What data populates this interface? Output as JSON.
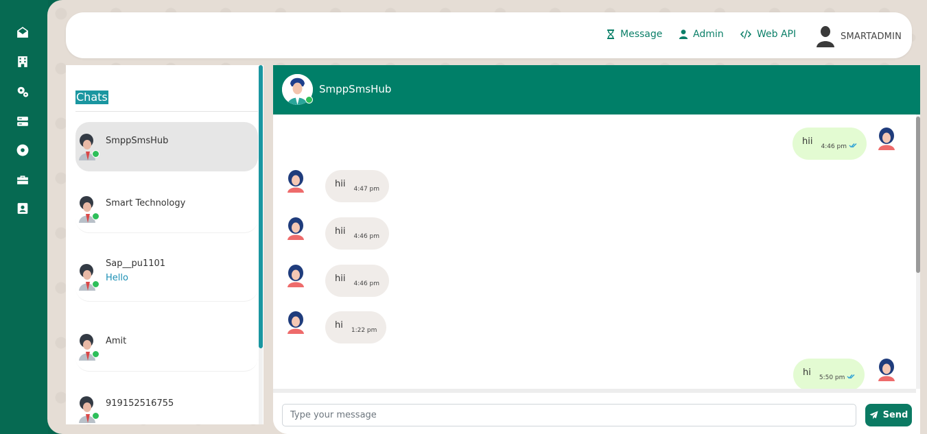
{
  "sidebar": {
    "icons": [
      "envelope-open-icon",
      "building-icon",
      "cogs-icon",
      "server-icon",
      "dot-circle-icon",
      "toolbox-icon",
      "id-badge-icon"
    ]
  },
  "topbar": {
    "nav": [
      {
        "label": "Message",
        "icon": "hourglass-icon"
      },
      {
        "label": "Admin",
        "icon": "user-icon"
      },
      {
        "label": "Web API",
        "icon": "code-icon"
      }
    ],
    "user_name": "SMARTADMIN"
  },
  "chats": {
    "title": "Chats",
    "items": [
      {
        "name": "SmppSmsHub",
        "preview": "",
        "active": true
      },
      {
        "name": "Smart Technology",
        "preview": ""
      },
      {
        "name": "Sap__pu1101",
        "preview": "Hello"
      },
      {
        "name": "Amit",
        "preview": ""
      },
      {
        "name": "919152516755",
        "preview": ""
      }
    ]
  },
  "conversation": {
    "title": "SmppSmsHub",
    "messages": [
      {
        "direction": "out",
        "text": "hii",
        "time": "4:46 pm",
        "read": true
      },
      {
        "direction": "in",
        "text": "hii",
        "time": "4:47 pm"
      },
      {
        "direction": "in",
        "text": "hii",
        "time": "4:46 pm"
      },
      {
        "direction": "in",
        "text": "hii",
        "time": "4:46 pm"
      },
      {
        "direction": "in",
        "text": "hi",
        "time": "1:22 pm"
      },
      {
        "direction": "out",
        "text": "hi",
        "time": "5:50 pm",
        "read": true
      }
    ],
    "input_placeholder": "Type your message",
    "input_value": "",
    "send_label": "Send"
  },
  "colors": {
    "brand": "#007f68",
    "sidebar": "#066a52",
    "accent": "#1a96a0",
    "online": "#2ebf5a",
    "bubble_in": "#f0ece9",
    "bubble_out": "#e3fbd2"
  }
}
